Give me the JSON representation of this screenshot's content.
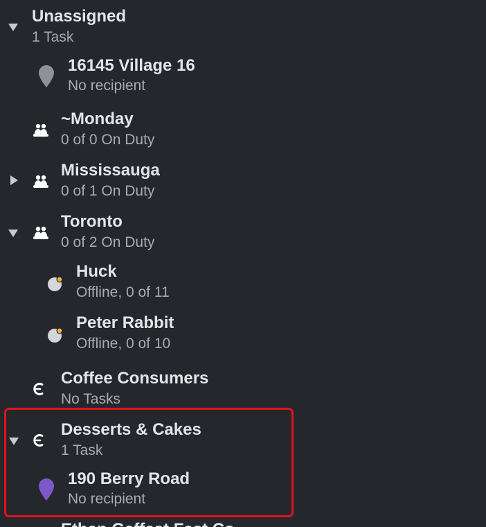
{
  "groups": {
    "unassigned": {
      "title": "Unassigned",
      "sub": "1 Task"
    },
    "task1": {
      "title": "16145 Village 16",
      "sub": "No recipient"
    },
    "monday": {
      "title": "~Monday",
      "sub": "0 of 0 On Duty"
    },
    "mississauga": {
      "title": "Mississauga",
      "sub": "0 of 1 On Duty"
    },
    "toronto": {
      "title": "Toronto",
      "sub": "0 of 2 On Duty"
    },
    "huck": {
      "title": "Huck",
      "sub": "Offline, 0 of 11"
    },
    "peter": {
      "title": "Peter Rabbit",
      "sub": "Offline, 0 of 10"
    },
    "coffee": {
      "title": "Coffee Consumers",
      "sub": "No Tasks"
    },
    "desserts": {
      "title": "Desserts & Cakes",
      "sub": "1 Task"
    },
    "task2": {
      "title": "190 Berry Road",
      "sub": "No recipient"
    },
    "partial": {
      "title": "Ethan Gaffest Fast Co..."
    }
  },
  "colors": {
    "background": "#24272c",
    "highlight_border": "#e0141b",
    "pin_gray": "#8e9196",
    "pin_purple": "#7e57c8",
    "status_dot": "#f5b731"
  },
  "icons": {
    "expanded": "triangle-down-icon",
    "collapsed": "triangle-right-icon",
    "team": "team-icon",
    "hub": "hub-icon",
    "pin": "map-pin-icon",
    "worker": "worker-offline-icon"
  }
}
